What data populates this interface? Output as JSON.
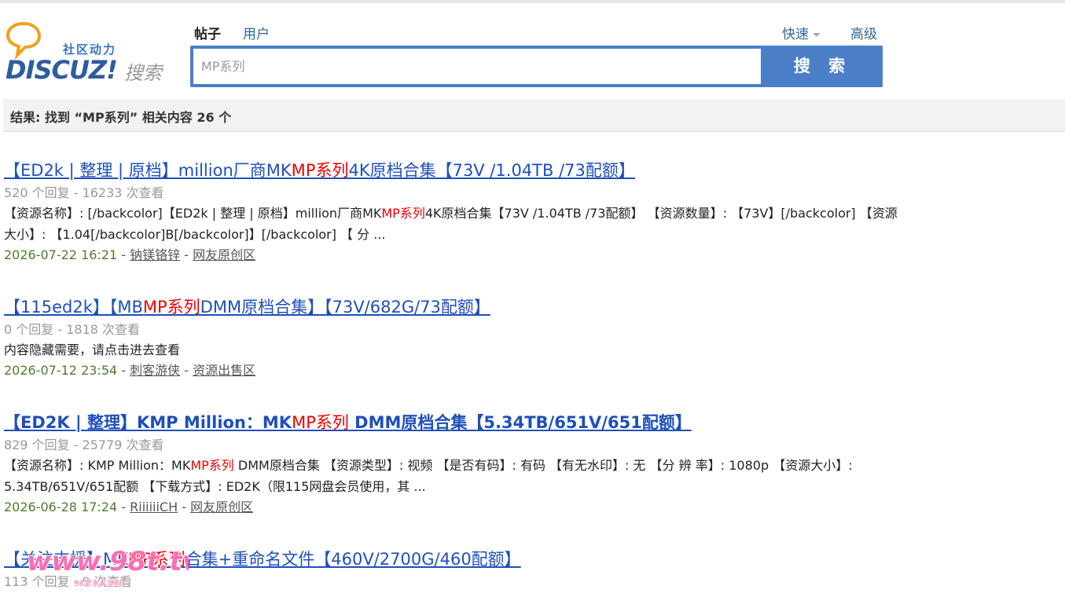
{
  "logo": {
    "cn": "社区动力",
    "brand": "DISCUZ!",
    "sub": "搜索"
  },
  "tabs": {
    "posts": "帖子",
    "users": "用户"
  },
  "quick_label": "快速",
  "advanced_label": "高级",
  "search": {
    "value": "MP系列",
    "button_label": "搜 索"
  },
  "result_summary": "结果: 找到 “MP系列” 相关内容 26 个",
  "results": [
    {
      "title_pre": "【ED2k | 整理 | 原档】million厂商MK",
      "title_hl": "MP系列",
      "title_post": "4K原档合集【73V /1.04TB /73配额】",
      "meta": "520 个回复 - 16233 次查看",
      "desc_pre": "【资源名称】: [/backcolor]【ED2k | 整理 | 原档】million厂商MK",
      "desc_hl": "MP系列",
      "desc_post": "4K原档合集【73V /1.04TB /73配额】 【资源数量】: 【73V】[/backcolor] 【资源大小】: 【1.04[/backcolor]B[/backcolor]】[/backcolor] 【 分 ...",
      "date": "2026-07-22 16:21",
      "author": "钠镁铬锌",
      "forum": "网友原创区"
    },
    {
      "title_pre": "【115ed2k】【MB",
      "title_hl": "MP系列",
      "title_post": "DMM原档合集】【73V/682G/73配额】",
      "meta": "0 个回复 - 1818 次查看",
      "desc_pre": "内容隐藏需要，请点击进去查看",
      "desc_hl": "",
      "desc_post": "",
      "date": "2026-07-12 23:54",
      "author": "刺客游侠",
      "forum": "资源出售区"
    },
    {
      "title_pre": "【ED2K | 整理】KMP Million：MK",
      "title_hl": "MP系列",
      "title_post": " DMM原档合集【5.34TB/651V/651配额】",
      "meta": "829 个回复 - 25779 次查看",
      "desc_pre": "【资源名称】: KMP Million：MK",
      "desc_hl": "MP系列",
      "desc_post": " DMM原档合集 【资源类型】: 视频 【是否有码】: 有码 【有无水印】: 无 【分 辨 率】: 1080p 【资源大小】: 5.34TB/651V/651配额 【下载方式】: ED2K（限115网盘会员使用，其 ...",
      "date": "2026-06-28 17:24",
      "author": "RiiiiiiCH",
      "forum": "网友原创区"
    },
    {
      "title_pre": "【关注支援】MK",
      "title_hl": "MP系列",
      "title_post": "合集+重命名文件【460V/2700G/460配额】",
      "meta": "113 个回复 - 9 次查看"
    }
  ],
  "watermark": {
    "text": "www.98t.tv",
    "sub": "98堂永久地址"
  },
  "colors": {
    "accent": "#4a7fc7",
    "link": "#1f4fb8",
    "highlight": "#ee0000",
    "date": "#4f7b2e"
  }
}
